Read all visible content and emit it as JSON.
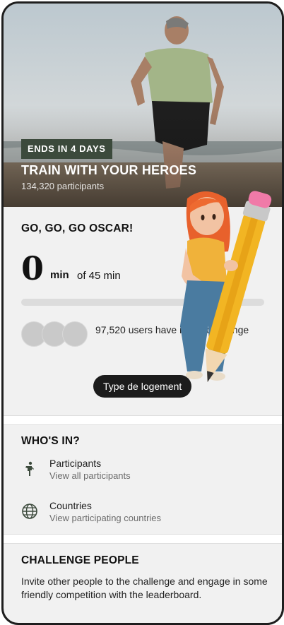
{
  "hero": {
    "badge": "ENDS IN 4 DAYS",
    "title": "TRAIN WITH YOUR HEROES",
    "participants": "134,320 participants"
  },
  "progress_card": {
    "greeting": "GO, GO, GO OSCAR!",
    "minutes_done": "0",
    "minutes_unit": "min",
    "minutes_goal": "of 45 min",
    "progress_fraction": 0,
    "users_text": "97,520 users have      in the challenge",
    "tooltip": "Type de logement"
  },
  "whos_in": {
    "title": "WHO'S IN?",
    "items": [
      {
        "label": "Participants",
        "sub": "View all participants",
        "icon": "person-running-icon"
      },
      {
        "label": "Countries",
        "sub": "View participating countries",
        "icon": "globe-icon"
      }
    ]
  },
  "challenge_people": {
    "title": "CHALLENGE PEOPLE",
    "text": "Invite other people to the challenge and engage in some friendly competition with the leaderboard."
  },
  "colors": {
    "badge_bg": "#3c4a3c",
    "tooltip_bg": "#1c1c1c",
    "card_bg": "#f1f1f1"
  }
}
